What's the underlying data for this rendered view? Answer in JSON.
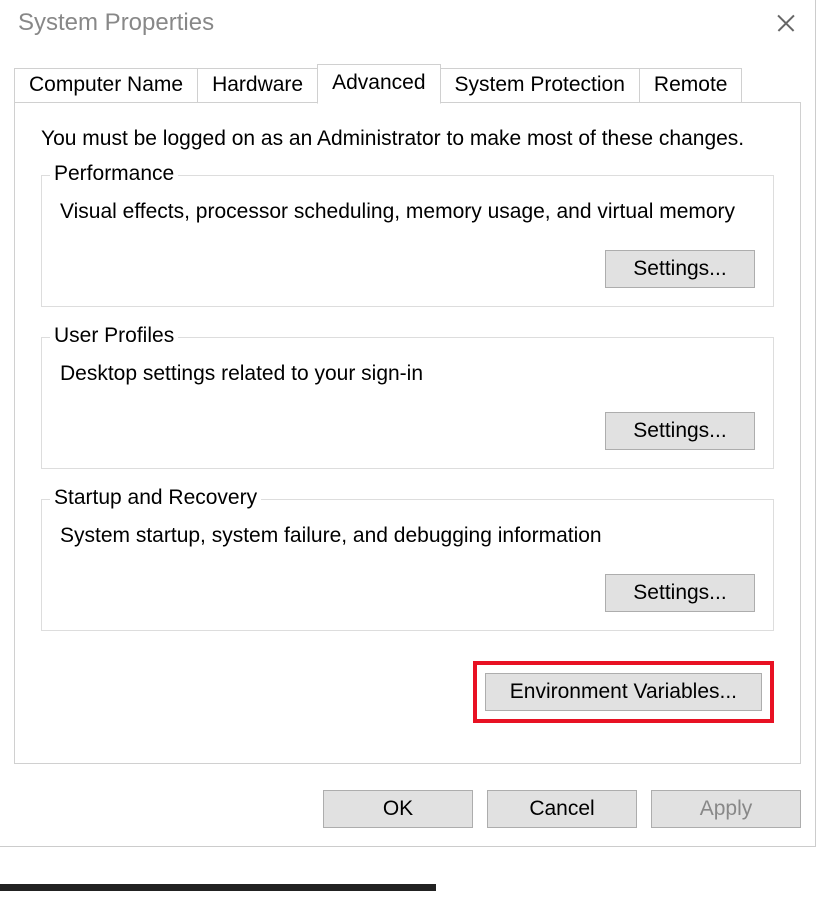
{
  "dialog": {
    "title": "System Properties",
    "tabs": [
      {
        "label": "Computer Name"
      },
      {
        "label": "Hardware"
      },
      {
        "label": "Advanced"
      },
      {
        "label": "System Protection"
      },
      {
        "label": "Remote"
      }
    ],
    "intro": "You must be logged on as an Administrator to make most of these changes.",
    "groups": {
      "performance": {
        "legend": "Performance",
        "desc": "Visual effects, processor scheduling, memory usage, and virtual memory",
        "button": "Settings..."
      },
      "user_profiles": {
        "legend": "User Profiles",
        "desc": "Desktop settings related to your sign-in",
        "button": "Settings..."
      },
      "startup_recovery": {
        "legend": "Startup and Recovery",
        "desc": "System startup, system failure, and debugging information",
        "button": "Settings..."
      }
    },
    "environment_button": "Environment Variables...",
    "buttons": {
      "ok": "OK",
      "cancel": "Cancel",
      "apply": "Apply"
    }
  }
}
